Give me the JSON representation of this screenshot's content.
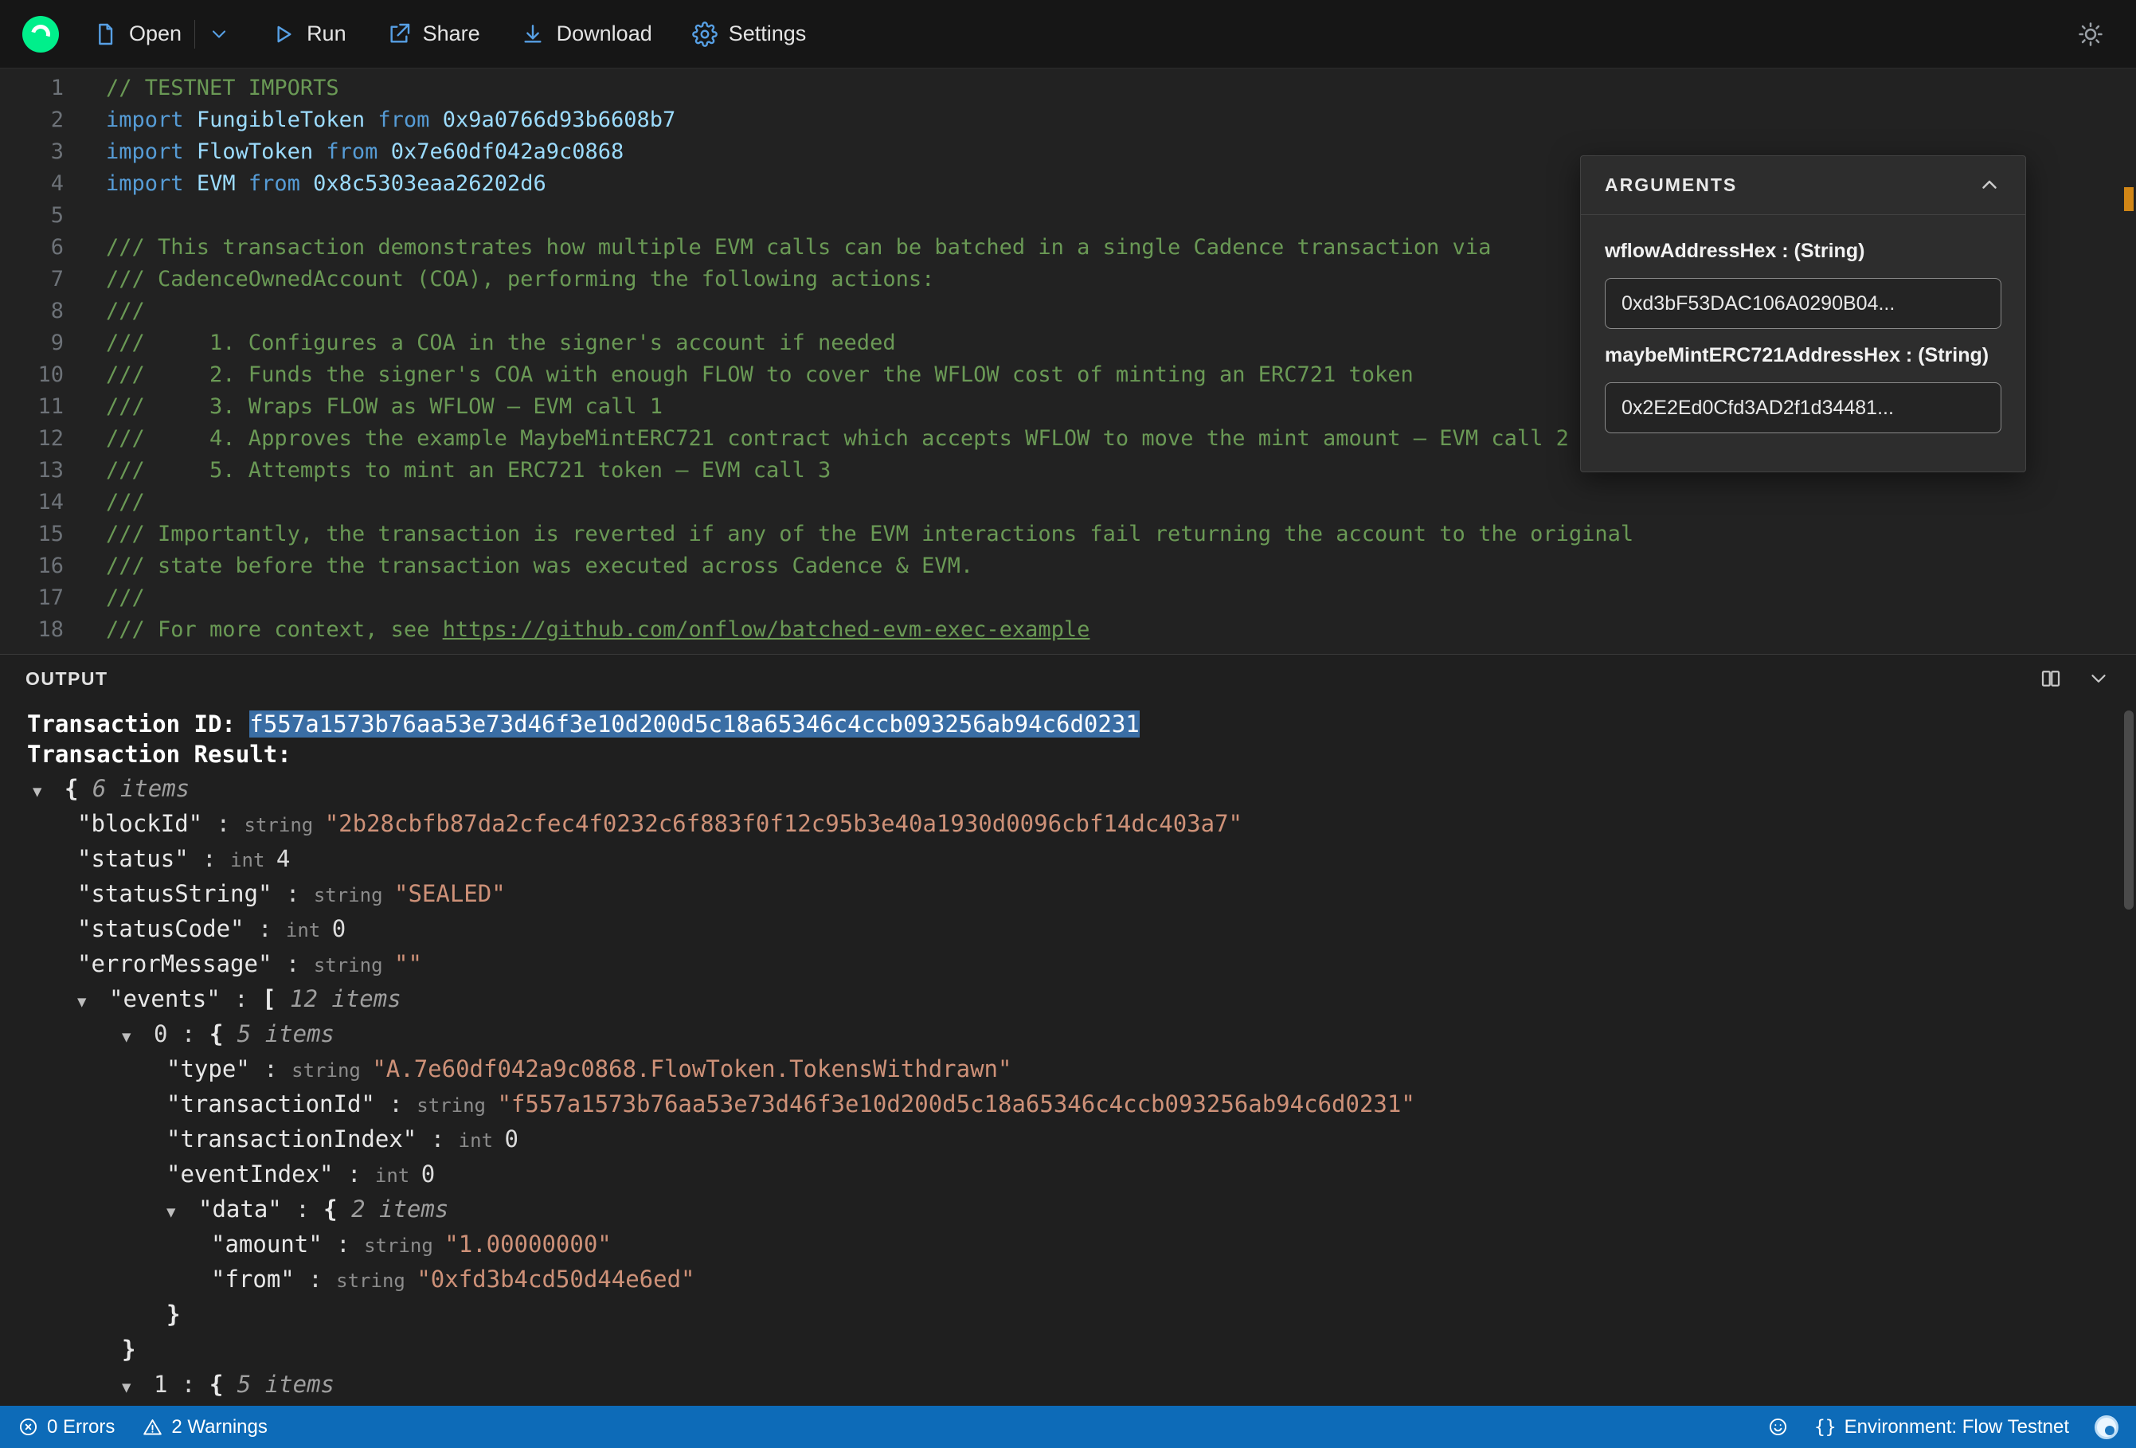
{
  "colors": {
    "accent": "#00ef8b",
    "icon-blue": "#57a0e5",
    "status-blue": "#0d6bb8",
    "selection-blue": "#3a6ea5",
    "comment-green": "#6a9955",
    "keyword-blue": "#569cd6",
    "ident-blue": "#9cdcfe",
    "string-orange": "#ce9178",
    "warning-orange": "#d18616"
  },
  "toolbar": {
    "open_label": "Open",
    "run_label": "Run",
    "share_label": "Share",
    "download_label": "Download",
    "settings_label": "Settings"
  },
  "arguments_panel": {
    "title": "ARGUMENTS",
    "fields": [
      {
        "label": "wflowAddressHex : (String)",
        "value": "0xd3bF53DAC106A0290B04..."
      },
      {
        "label": "maybeMintERC721AddressHex : (String)",
        "value": "0x2E2Ed0Cfd3AD2f1d34481..."
      }
    ]
  },
  "editor": {
    "lines": [
      {
        "n": "1",
        "t": [
          {
            "s": "c",
            "v": "// TESTNET IMPORTS"
          }
        ]
      },
      {
        "n": "2",
        "t": [
          {
            "s": "k",
            "v": "import"
          },
          {
            "s": "p",
            "v": " "
          },
          {
            "s": "i",
            "v": "FungibleToken"
          },
          {
            "s": "p",
            "v": " "
          },
          {
            "s": "k",
            "v": "from"
          },
          {
            "s": "p",
            "v": " "
          },
          {
            "s": "a",
            "v": "0x9a0766d93b6608b7"
          }
        ]
      },
      {
        "n": "3",
        "t": [
          {
            "s": "k",
            "v": "import"
          },
          {
            "s": "p",
            "v": " "
          },
          {
            "s": "i",
            "v": "FlowToken"
          },
          {
            "s": "p",
            "v": " "
          },
          {
            "s": "k",
            "v": "from"
          },
          {
            "s": "p",
            "v": " "
          },
          {
            "s": "a",
            "v": "0x7e60df042a9c0868"
          }
        ]
      },
      {
        "n": "4",
        "t": [
          {
            "s": "k",
            "v": "import"
          },
          {
            "s": "p",
            "v": " "
          },
          {
            "s": "i",
            "v": "EVM"
          },
          {
            "s": "p",
            "v": " "
          },
          {
            "s": "k",
            "v": "from"
          },
          {
            "s": "p",
            "v": " "
          },
          {
            "s": "a",
            "v": "0x8c5303eaa26202d6"
          }
        ]
      },
      {
        "n": "5",
        "t": []
      },
      {
        "n": "6",
        "t": [
          {
            "s": "c",
            "v": "/// This transaction demonstrates how multiple EVM calls can be batched in a single Cadence transaction via"
          }
        ]
      },
      {
        "n": "7",
        "t": [
          {
            "s": "c",
            "v": "/// CadenceOwnedAccount (COA), performing the following actions:"
          }
        ]
      },
      {
        "n": "8",
        "t": [
          {
            "s": "c",
            "v": "///"
          }
        ]
      },
      {
        "n": "9",
        "t": [
          {
            "s": "c",
            "v": "///     1. Configures a COA in the signer's account if needed"
          }
        ]
      },
      {
        "n": "10",
        "t": [
          {
            "s": "c",
            "v": "///     2. Funds the signer's COA with enough FLOW to cover the WFLOW cost of minting an ERC721 token"
          }
        ]
      },
      {
        "n": "11",
        "t": [
          {
            "s": "c",
            "v": "///     3. Wraps FLOW as WFLOW — EVM call 1"
          }
        ]
      },
      {
        "n": "12",
        "t": [
          {
            "s": "c",
            "v": "///     4. Approves the example MaybeMintERC721 contract which accepts WFLOW to move the mint amount — EVM call 2"
          }
        ]
      },
      {
        "n": "13",
        "t": [
          {
            "s": "c",
            "v": "///     5. Attempts to mint an ERC721 token — EVM call 3"
          }
        ]
      },
      {
        "n": "14",
        "t": [
          {
            "s": "c",
            "v": "///"
          }
        ]
      },
      {
        "n": "15",
        "t": [
          {
            "s": "c",
            "v": "/// Importantly, the transaction is reverted if any of the EVM interactions fail returning the account to the original"
          }
        ]
      },
      {
        "n": "16",
        "t": [
          {
            "s": "c",
            "v": "/// state before the transaction was executed across Cadence & EVM."
          }
        ]
      },
      {
        "n": "17",
        "t": [
          {
            "s": "c",
            "v": "///"
          }
        ]
      },
      {
        "n": "18",
        "t": [
          {
            "s": "c",
            "v": "/// For more context, see "
          },
          {
            "s": "l",
            "v": "https://github.com/onflow/batched-evm-exec-example"
          }
        ]
      }
    ]
  },
  "output": {
    "title": "OUTPUT",
    "transaction_id_label": "Transaction ID: ",
    "transaction_id": "f557a1573b76aa53e73d46f3e10d200d5c18a65346c4ccb093256ab94c6d0231",
    "transaction_result_label": "Transaction Result:",
    "tree": [
      {
        "indent": 0,
        "arrow": true,
        "t": [
          {
            "s": "b",
            "v": "{ "
          },
          {
            "s": "it",
            "v": "6 items"
          }
        ]
      },
      {
        "indent": 1,
        "arrow": false,
        "t": [
          {
            "s": "key",
            "v": "\"blockId\""
          },
          {
            "s": "p",
            "v": " : "
          },
          {
            "s": "ty",
            "v": "string "
          },
          {
            "s": "str",
            "v": "\"2b28cbfb87da2cfec4f0232c6f883f0f12c95b3e40a1930d0096cbf14dc403a7\""
          }
        ]
      },
      {
        "indent": 1,
        "arrow": false,
        "t": [
          {
            "s": "key",
            "v": "\"status\""
          },
          {
            "s": "p",
            "v": " : "
          },
          {
            "s": "ty",
            "v": "int "
          },
          {
            "s": "num",
            "v": "4"
          }
        ]
      },
      {
        "indent": 1,
        "arrow": false,
        "t": [
          {
            "s": "key",
            "v": "\"statusString\""
          },
          {
            "s": "p",
            "v": " : "
          },
          {
            "s": "ty",
            "v": "string "
          },
          {
            "s": "str",
            "v": "\"SEALED\""
          }
        ]
      },
      {
        "indent": 1,
        "arrow": false,
        "t": [
          {
            "s": "key",
            "v": "\"statusCode\""
          },
          {
            "s": "p",
            "v": " : "
          },
          {
            "s": "ty",
            "v": "int "
          },
          {
            "s": "num",
            "v": "0"
          }
        ]
      },
      {
        "indent": 1,
        "arrow": false,
        "t": [
          {
            "s": "key",
            "v": "\"errorMessage\""
          },
          {
            "s": "p",
            "v": " : "
          },
          {
            "s": "ty",
            "v": "string "
          },
          {
            "s": "str",
            "v": "\"\""
          }
        ]
      },
      {
        "indent": 1,
        "arrow": true,
        "t": [
          {
            "s": "key",
            "v": "\"events\""
          },
          {
            "s": "p",
            "v": " : "
          },
          {
            "s": "b",
            "v": "[ "
          },
          {
            "s": "it",
            "v": "12 items"
          }
        ]
      },
      {
        "indent": 2,
        "arrow": true,
        "t": [
          {
            "s": "num",
            "v": "0"
          },
          {
            "s": "p",
            "v": " : "
          },
          {
            "s": "b",
            "v": "{ "
          },
          {
            "s": "it",
            "v": "5 items"
          }
        ]
      },
      {
        "indent": 3,
        "arrow": false,
        "t": [
          {
            "s": "key",
            "v": "\"type\""
          },
          {
            "s": "p",
            "v": " : "
          },
          {
            "s": "ty",
            "v": "string "
          },
          {
            "s": "str",
            "v": "\"A.7e60df042a9c0868.FlowToken.TokensWithdrawn\""
          }
        ]
      },
      {
        "indent": 3,
        "arrow": false,
        "t": [
          {
            "s": "key",
            "v": "\"transactionId\""
          },
          {
            "s": "p",
            "v": " : "
          },
          {
            "s": "ty",
            "v": "string "
          },
          {
            "s": "str",
            "v": "\"f557a1573b76aa53e73d46f3e10d200d5c18a65346c4ccb093256ab94c6d0231\""
          }
        ]
      },
      {
        "indent": 3,
        "arrow": false,
        "t": [
          {
            "s": "key",
            "v": "\"transactionIndex\""
          },
          {
            "s": "p",
            "v": " : "
          },
          {
            "s": "ty",
            "v": "int "
          },
          {
            "s": "num",
            "v": "0"
          }
        ]
      },
      {
        "indent": 3,
        "arrow": false,
        "t": [
          {
            "s": "key",
            "v": "\"eventIndex\""
          },
          {
            "s": "p",
            "v": " : "
          },
          {
            "s": "ty",
            "v": "int "
          },
          {
            "s": "num",
            "v": "0"
          }
        ]
      },
      {
        "indent": 3,
        "arrow": true,
        "t": [
          {
            "s": "key",
            "v": "\"data\""
          },
          {
            "s": "p",
            "v": " : "
          },
          {
            "s": "b",
            "v": "{ "
          },
          {
            "s": "it",
            "v": "2 items"
          }
        ]
      },
      {
        "indent": 4,
        "arrow": false,
        "t": [
          {
            "s": "key",
            "v": "\"amount\""
          },
          {
            "s": "p",
            "v": " : "
          },
          {
            "s": "ty",
            "v": "string "
          },
          {
            "s": "str",
            "v": "\"1.00000000\""
          }
        ]
      },
      {
        "indent": 4,
        "arrow": false,
        "t": [
          {
            "s": "key",
            "v": "\"from\""
          },
          {
            "s": "p",
            "v": " : "
          },
          {
            "s": "ty",
            "v": "string "
          },
          {
            "s": "str",
            "v": "\"0xfd3b4cd50d44e6ed\""
          }
        ]
      },
      {
        "indent": 3,
        "arrow": false,
        "t": [
          {
            "s": "b",
            "v": "}"
          }
        ]
      },
      {
        "indent": 2,
        "arrow": false,
        "t": [
          {
            "s": "b",
            "v": "}"
          }
        ]
      },
      {
        "indent": 2,
        "arrow": true,
        "t": [
          {
            "s": "num",
            "v": "1"
          },
          {
            "s": "p",
            "v": " : "
          },
          {
            "s": "b",
            "v": "{ "
          },
          {
            "s": "it",
            "v": "5 items"
          }
        ]
      }
    ]
  },
  "status_bar": {
    "errors": "0 Errors",
    "warnings": "2 Warnings",
    "braces_glyph": "{}",
    "environment": "Environment: Flow Testnet"
  }
}
